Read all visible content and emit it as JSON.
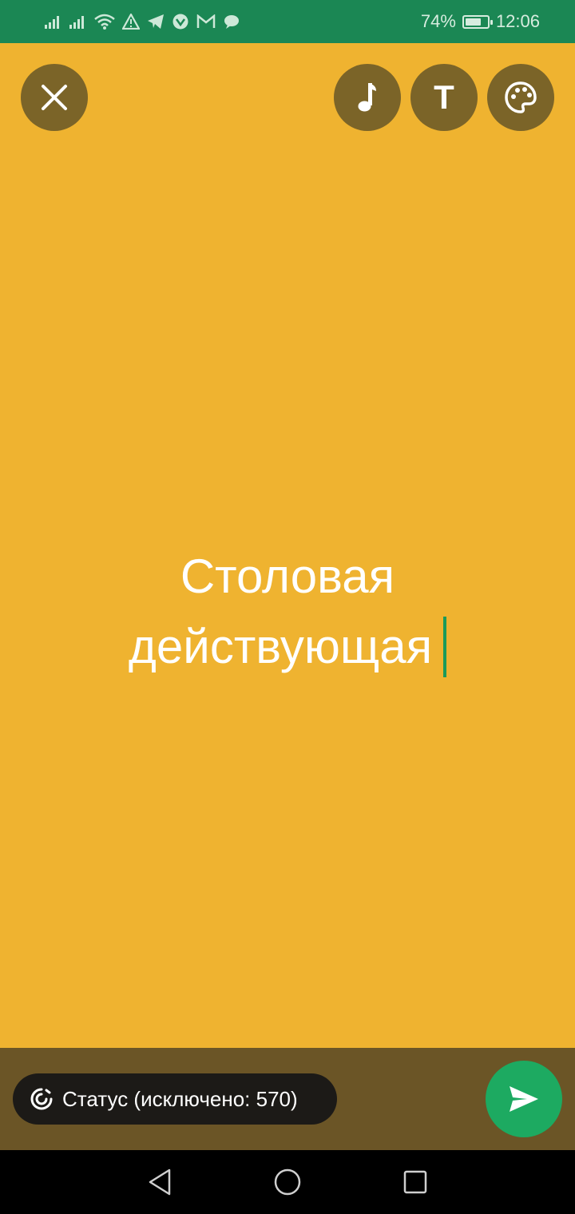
{
  "status_bar": {
    "battery": "74%",
    "battery_level": 0.74,
    "time": "12:06",
    "icons": [
      "signal-icon",
      "signal-icon",
      "wifi-icon",
      "warning-icon",
      "telegram-icon",
      "vpn-icon",
      "gmail-icon",
      "message-icon"
    ]
  },
  "toolbar": {
    "close": "close-icon",
    "music": "music-note-icon",
    "text_label": "T",
    "palette": "palette-icon"
  },
  "editor": {
    "line1": "Столовая",
    "line2": "действующая",
    "background_color": "#EFB330"
  },
  "footer": {
    "audience_label": "Статус (исключено: 570)",
    "send": "send-icon"
  },
  "colors": {
    "status_bar": "#1B8754",
    "button_bg": "#7B6428",
    "bottom_bar": "#6B5526",
    "send_button": "#1DAA61",
    "caret": "#1B9A5A"
  }
}
